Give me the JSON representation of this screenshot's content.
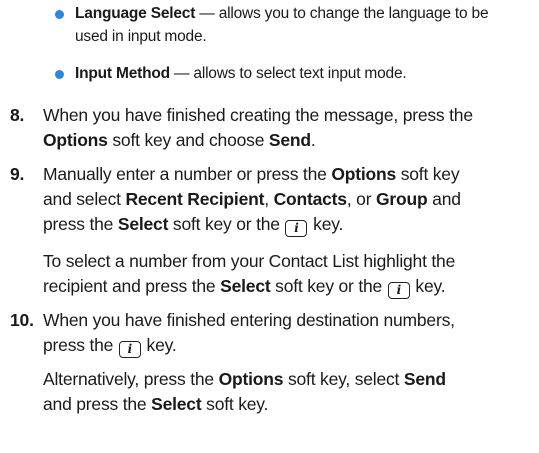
{
  "colors": {
    "bullet": "#2e86d6",
    "text": "#1a1a1a"
  },
  "bullets": [
    {
      "term": "Language Select",
      "rest": " — allows you to change the language to be",
      "cont": "used in input mode."
    },
    {
      "term": "Input Method",
      "rest": " — allows to select text input mode."
    }
  ],
  "steps": {
    "s8": {
      "num": "8.",
      "l1": "When you have finished creating the message, press the",
      "opt": "Options",
      "l2a": " soft key and choose ",
      "send": "Send",
      "l2b": "."
    },
    "s9": {
      "num": "9.",
      "l1a": "Manually enter a number or press the ",
      "opt": "Options",
      "l1b": " soft key",
      "l2a": "and select ",
      "recent": "Recent Recipient",
      "c1": ", ",
      "contacts": "Contacts",
      "c2": ", or ",
      "group": "Group",
      "l2b": " and",
      "l3a": "press the ",
      "select": "Select",
      "l3b": " soft key or the ",
      "l3c": " key."
    },
    "p9": {
      "l1": "To select a number from your Contact List highlight the",
      "l2a": "recipient and press the ",
      "select": "Select",
      "l2b": " soft key or the ",
      "l2c": " key."
    },
    "s10": {
      "num": "10.",
      "l1": "When you have finished entering destination numbers,",
      "l2a": "press the ",
      "l2b": " key."
    },
    "p10": {
      "l1a": "Alternatively, press the ",
      "opt": "Options",
      "l1b": " soft key, select ",
      "send": "Send",
      "l2a": "and press the ",
      "select": "Select",
      "l2b": " soft key."
    }
  },
  "key_glyph": "i"
}
